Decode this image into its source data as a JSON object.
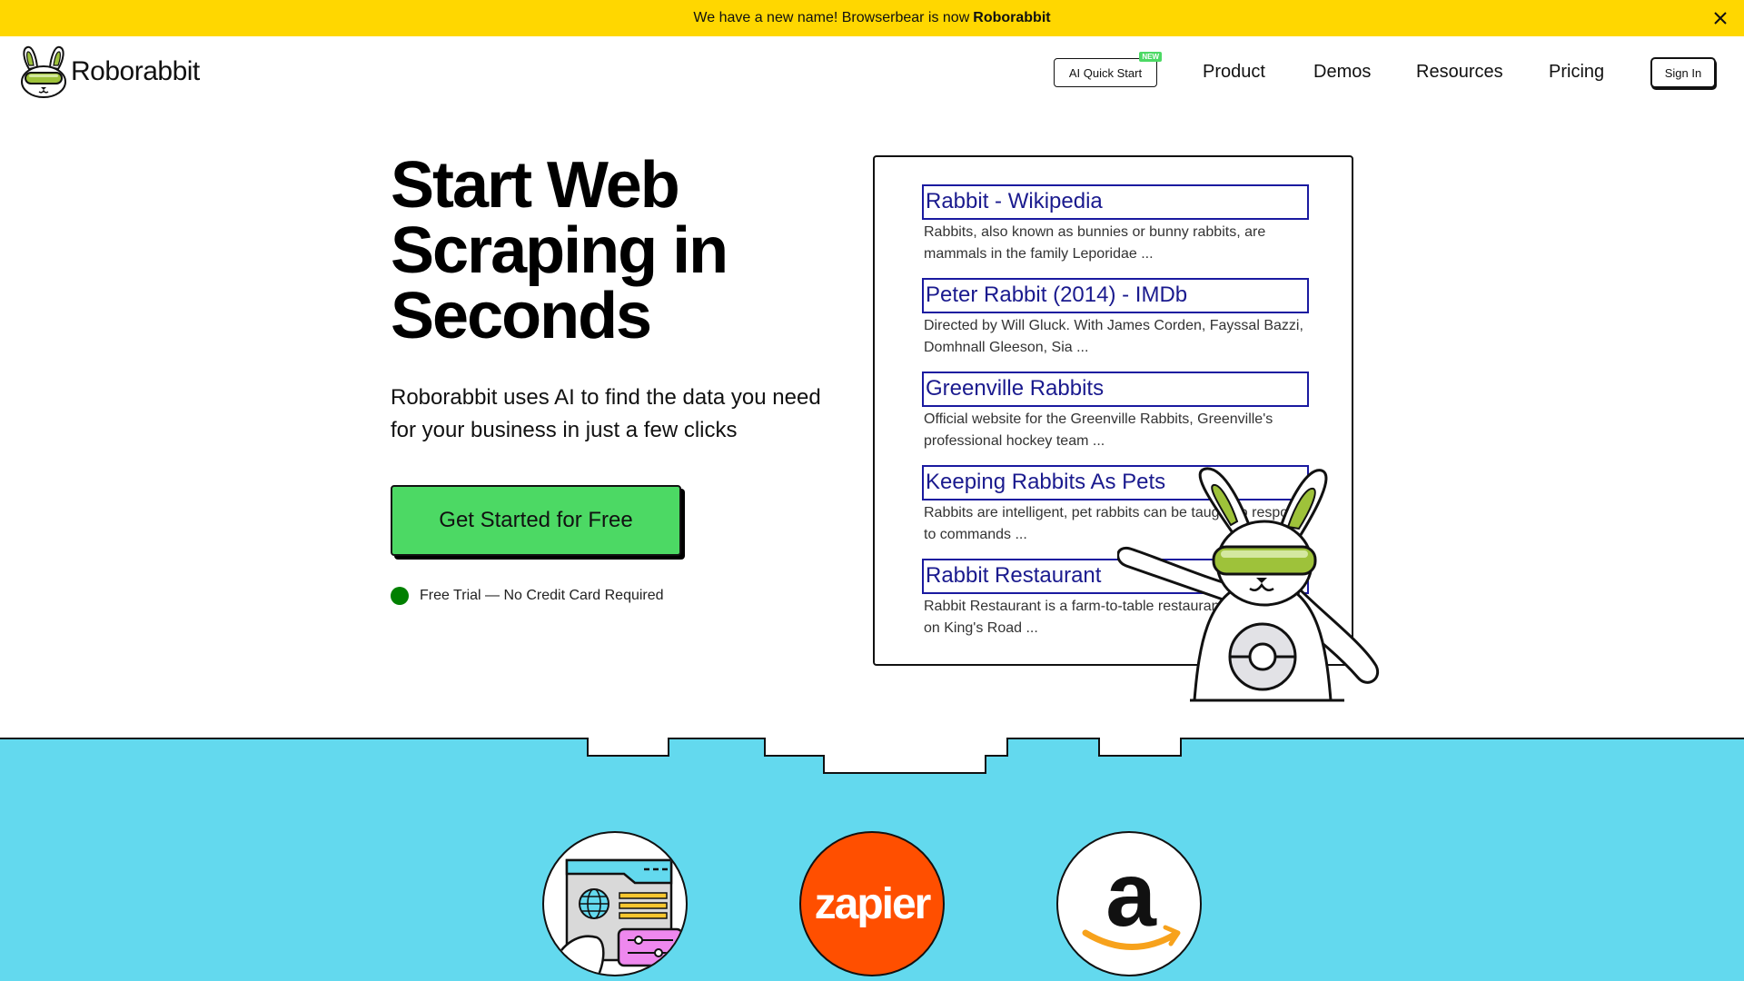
{
  "announcement": {
    "text": "We have a new name! Browserbear is now",
    "highlight": "Roborabbit",
    "close_icon": "close-icon",
    "background": "#FFD700"
  },
  "nav": {
    "logo_text": "Roborabbit",
    "quick_start_label": "AI Quick Start",
    "quick_start_badge": "NEW",
    "links": [
      "Product",
      "Demos",
      "Resources",
      "Pricing"
    ],
    "signin_label": "Sign In"
  },
  "hero": {
    "title": "Start Web Scraping in Seconds",
    "subtitle": "Roborabbit uses AI to find the data you need for your business in just a few clicks",
    "cta_label": "Get Started for Free",
    "cta_color": "#4cd964",
    "trial_text": "Free Trial — No Credit Card Required"
  },
  "results": [
    {
      "title": "Rabbit - Wikipedia",
      "desc": "Rabbits, also known as bunnies or bunny rabbits, are mammals in the family Leporidae ..."
    },
    {
      "title": "Peter Rabbit (2014) - IMDb",
      "desc": "Directed by Will Gluck. With James Corden, Fayssal Bazzi, Domhnall Gleeson, Sia ..."
    },
    {
      "title": "Greenville Rabbits",
      "desc": "Official website for the Greenville Rabbits, Greenville's professional hockey team ..."
    },
    {
      "title": "Keeping Rabbits As Pets",
      "desc": "Rabbits are intelligent, pet rabbits can be taught to respond to commands ..."
    },
    {
      "title": "Rabbit Restaurant",
      "desc": "Rabbit Restaurant is a farm-to-table restaurant in Chelsea on King's Road ..."
    }
  ],
  "integrations": {
    "background": "#63D9EE",
    "items": [
      {
        "name": "web-scraper",
        "icon": "browser-settings-icon"
      },
      {
        "name": "zapier",
        "label": "zapier",
        "color": "#FF4F00"
      },
      {
        "name": "amazon",
        "label": "a",
        "icon": "amazon-logo-icon"
      }
    ]
  }
}
